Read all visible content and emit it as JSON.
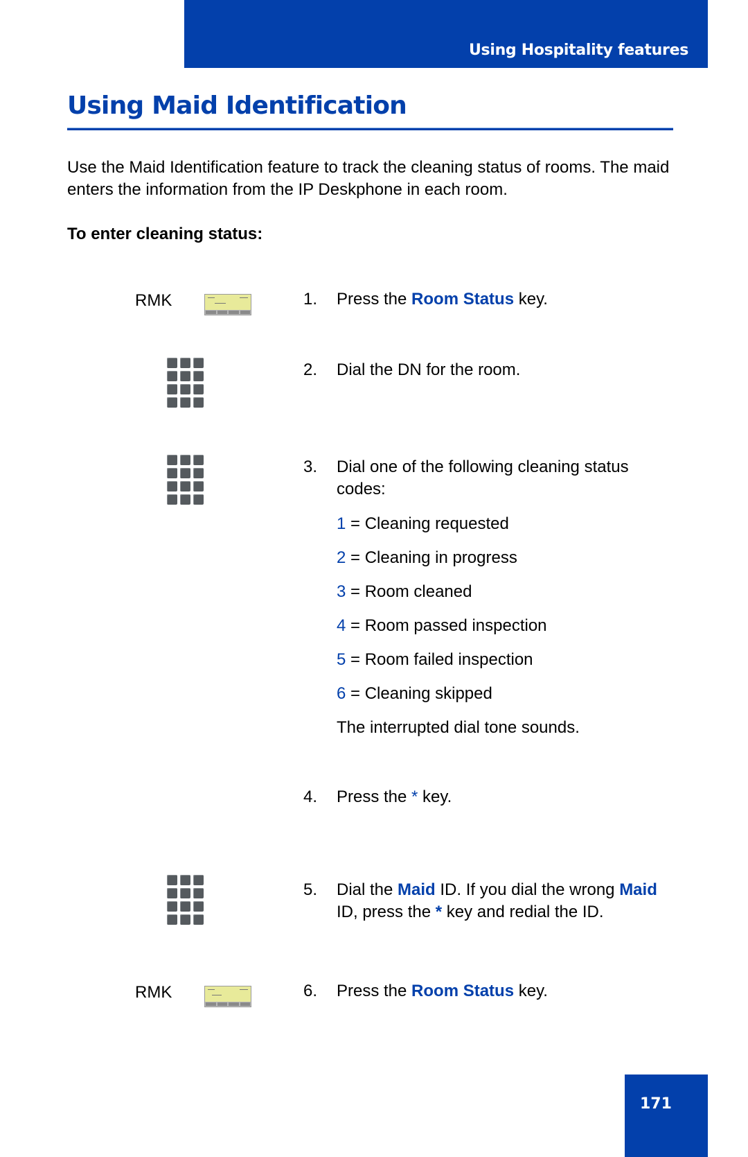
{
  "header": {
    "section_title": "Using Hospitality features"
  },
  "page": {
    "title": "Using Maid Identification",
    "intro": "Use the Maid Identification feature to track the cleaning status of rooms. The maid enters the information from the IP Deskphone in each room.",
    "procedure_heading": "To enter cleaning status:",
    "page_number": "171"
  },
  "icons": {
    "rmk_label": "RMK",
    "display": "phone-display-softkey-icon",
    "keypad": "dialpad-icon"
  },
  "steps": [
    {
      "num": "1.",
      "pre": "Press the ",
      "key": "Room Status",
      "post": " key."
    },
    {
      "num": "2.",
      "text": "Dial the DN for the room."
    },
    {
      "num": "3.",
      "text": "Dial one of the following cleaning status codes:"
    },
    {
      "num": "4.",
      "pre": "Press the ",
      "key": "*",
      "post": " key."
    },
    {
      "num": "5.",
      "pre": "Dial the ",
      "key": "Maid",
      "mid": " ID. If you dial the wrong ",
      "key2": "Maid",
      "mid2": " ID, press the ",
      "key3": "*",
      "post": " key and redial the ID."
    },
    {
      "num": "6.",
      "pre": "Press the ",
      "key": "Room Status",
      "post": " key."
    }
  ],
  "status_codes": [
    {
      "code": "1",
      "label": " = Cleaning requested"
    },
    {
      "code": "2",
      "label": " = Cleaning in progress"
    },
    {
      "code": "3",
      "label": " = Room cleaned"
    },
    {
      "code": "4",
      "label": " = Room passed inspection"
    },
    {
      "code": "5",
      "label": " = Room failed inspection"
    },
    {
      "code": "6",
      "label": " = Cleaning skipped"
    }
  ],
  "step3_note": "The interrupted dial tone sounds.",
  "colors": {
    "brand_blue": "#0340ab"
  }
}
